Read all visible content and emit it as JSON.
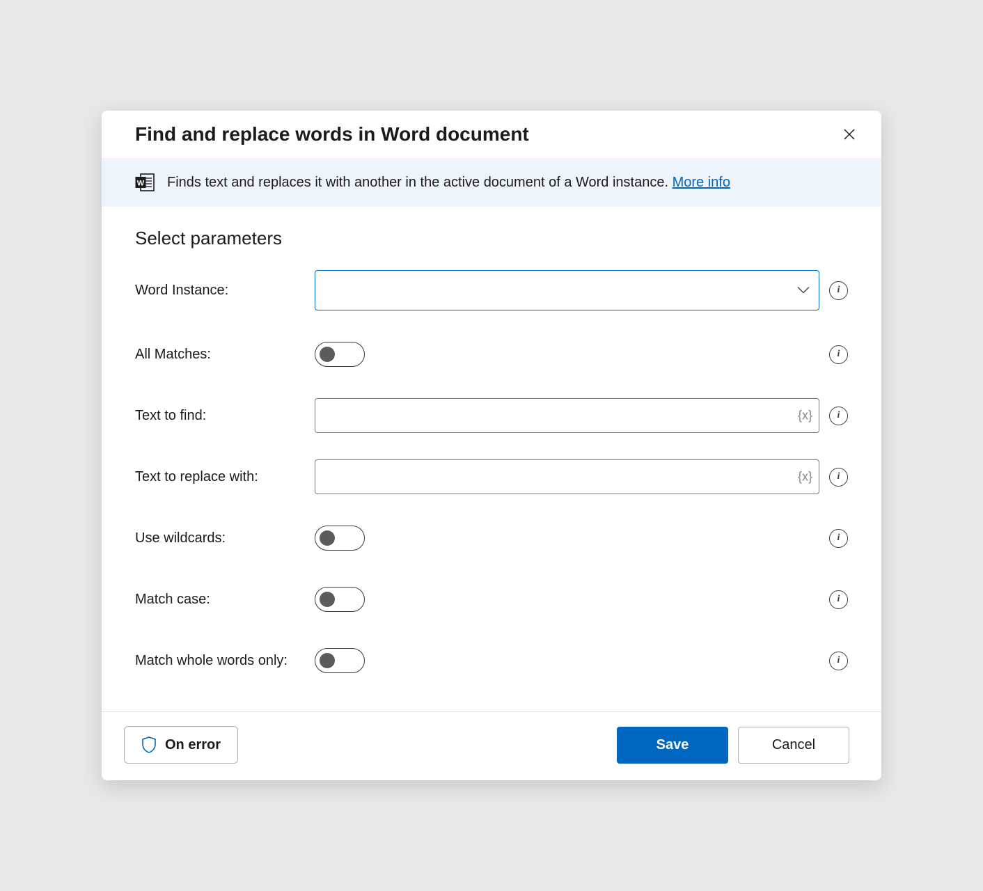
{
  "dialog": {
    "title": "Find and replace words in Word document"
  },
  "banner": {
    "text": "Finds text and replaces it with another in the active document of a Word instance. ",
    "link": "More info"
  },
  "section_title": "Select parameters",
  "params": {
    "word_instance": {
      "label": "Word Instance:",
      "value": ""
    },
    "all_matches": {
      "label": "All Matches:",
      "value": false
    },
    "text_to_find": {
      "label": "Text to find:",
      "value": ""
    },
    "text_to_replace": {
      "label": "Text to replace with:",
      "value": ""
    },
    "use_wildcards": {
      "label": "Use wildcards:",
      "value": false
    },
    "match_case": {
      "label": "Match case:",
      "value": false
    },
    "match_whole_words": {
      "label": "Match whole words only:",
      "value": false
    }
  },
  "footer": {
    "on_error": "On error",
    "save": "Save",
    "cancel": "Cancel"
  }
}
